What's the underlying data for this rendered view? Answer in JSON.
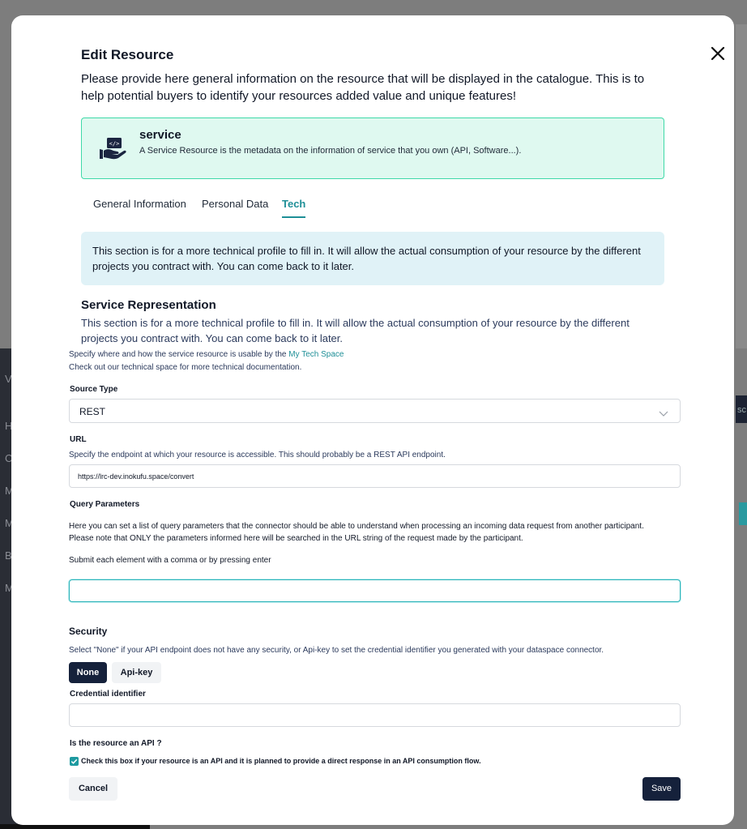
{
  "background": {
    "sidebar_letters": [
      "V",
      "H",
      "C",
      "M",
      "M",
      "B",
      "M"
    ],
    "right_button_text": "sc"
  },
  "modal": {
    "title": "Edit Resource",
    "intro": "Please provide here general information on the resource that will be displayed in the catalogue. This is to help potential buyers to identify your resources added value and unique features!",
    "close_icon": "close-icon"
  },
  "service_card": {
    "icon": "hand-code-icon",
    "name": "service",
    "description": "A Service Resource is the metadata on the information of service that you own (API, Software...)."
  },
  "tabs": [
    {
      "label": "General Information",
      "active": false
    },
    {
      "label": "Personal Data",
      "active": false
    },
    {
      "label": "Tech",
      "active": true
    }
  ],
  "info_box": "This section is for a more technical profile to fill in. It will allow the actual consumption of your resource by the different projects you contract with. You can come back to it later.",
  "service_representation": {
    "title": "Service Representation",
    "description": "This section is for a more technical profile to fill in. It will allow the actual consumption of your resource by the different projects you contract with. You can come back to it later.",
    "specify_prefix": "Specify where and how the service resource is usable by the",
    "specify_link": "My Tech Space",
    "check_out": "Check out our technical space for more technical documentation."
  },
  "source_type": {
    "label": "Source Type",
    "value": "REST"
  },
  "url": {
    "label": "URL",
    "hint": "Specify the endpoint at which your resource is accessible. This should probably be a REST API endpoint.",
    "value": "https://lrc-dev.inokufu.space/convert"
  },
  "query_parameters": {
    "label": "Query Parameters",
    "text_line1": "Here you can set a list of query parameters that the connector should be able to understand when processing an incoming data request from another participant.",
    "text_line2": "Please note that ONLY the parameters informed here will be searched in the URL string of the request made by the participant.",
    "submit_hint": "Submit each element with a comma or by pressing enter",
    "value": ""
  },
  "security": {
    "title": "Security",
    "hint": "Select \"None\" if your API endpoint does not have any security, or Api-key to set the credential identifier you generated with your dataspace connector.",
    "options": [
      "None",
      "Api-key"
    ],
    "selected": "None",
    "credential_label": "Credential identifier",
    "credential_value": ""
  },
  "api_question": {
    "label": "Is the resource an API ?",
    "checkbox_label": "Check this box if your resource is an API and it is planned to provide a direct response in an API consumption flow.",
    "checked": true
  },
  "footer": {
    "cancel": "Cancel",
    "save": "Save"
  },
  "colors": {
    "accent": "#1e8f97",
    "primary_dark": "#15213b",
    "card_bg": "#dff9f0",
    "card_border": "#3fd9a8",
    "info_bg": "#e0f2f7"
  }
}
